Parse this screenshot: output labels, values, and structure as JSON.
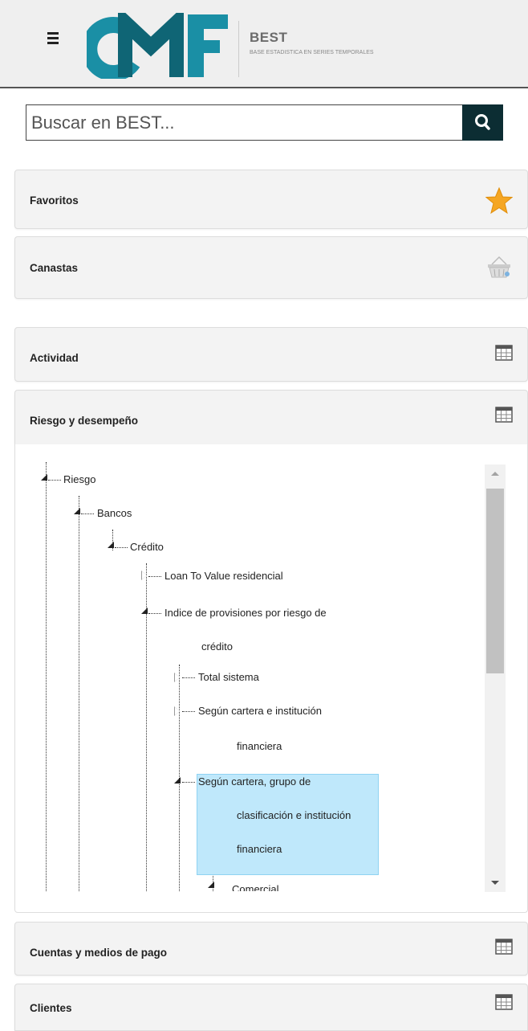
{
  "header": {
    "brand_title": "BEST",
    "brand_subtitle": "BASE ESTADISTICA EN SERIES TEMPORALES",
    "logo_text": "CMF",
    "logo_colors": {
      "c": "#1a8fa5",
      "m": "#0f6575",
      "f": "#1a8fa5"
    }
  },
  "search": {
    "placeholder": "Buscar en BEST..."
  },
  "panels": {
    "favoritos": {
      "label": "Favoritos",
      "icon": "star-icon"
    },
    "canastas": {
      "label": "Canastas",
      "icon": "basket-icon"
    },
    "actividad": {
      "label": "Actividad",
      "icon": "table-icon"
    },
    "riesgo": {
      "label": "Riesgo y desempeño",
      "icon": "table-icon"
    },
    "cuentas": {
      "label": "Cuentas y medios de pago",
      "icon": "table-icon"
    },
    "clientes": {
      "label": "Clientes",
      "icon": "table-icon"
    }
  },
  "tree": {
    "riesgo": "Riesgo",
    "bancos": "Bancos",
    "credito": "Crédito",
    "loan_to_value": "Loan To Value residencial",
    "indice_line1": "Indice de provisiones por riesgo de",
    "indice_line2": "crédito",
    "total_sistema": "Total sistema",
    "segun_cartera_inst_line1": "Según cartera e institución",
    "segun_cartera_inst_line2": "financiera",
    "segun_grupo_line1": "Según cartera, grupo de",
    "segun_grupo_line2": "clasificación e institución",
    "segun_grupo_line3": "financiera",
    "comercial": "Comercial"
  },
  "colors": {
    "accent_dark": "#0c2d33",
    "highlight": "#bfe8fb",
    "star": "#f5a623"
  }
}
